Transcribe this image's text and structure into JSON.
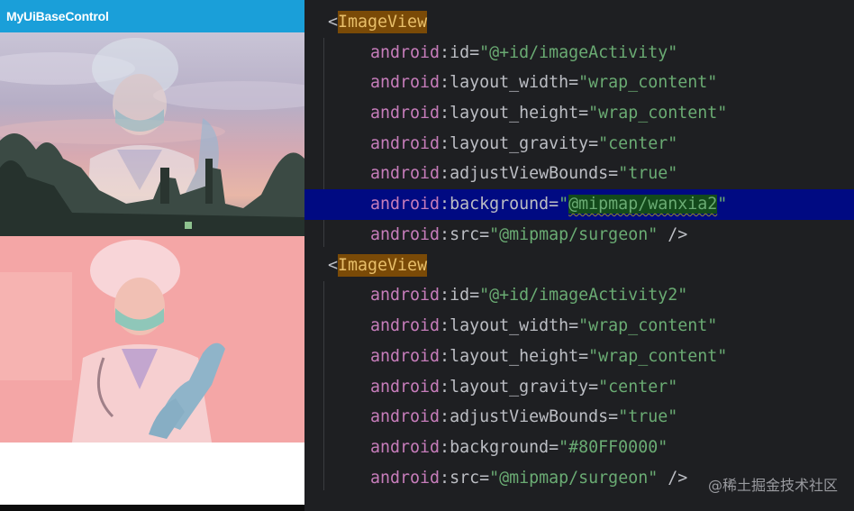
{
  "app": {
    "title": "MyUiBaseControl"
  },
  "colors": {
    "appbar": "#1a9fd9",
    "editor_background": "#1e1f22",
    "tag_name": "#e8bf6a",
    "namespace": "#c77dbb",
    "string": "#6aab73",
    "selection": "#000a82",
    "tint_overlay": "#80FF0000"
  },
  "preview": {
    "image1": {
      "subject": "surgeon",
      "background": "sunset sky over trees"
    },
    "image2": {
      "subject": "surgeon",
      "tint": "#80FF0000"
    }
  },
  "code": {
    "lines": [
      {
        "open": "<",
        "tag": "ImageView"
      },
      {
        "ns": "android",
        "attr": "id",
        "value": "\"@+id/imageActivity\""
      },
      {
        "ns": "android",
        "attr": "layout_width",
        "value": "\"wrap_content\""
      },
      {
        "ns": "android",
        "attr": "layout_height",
        "value": "\"wrap_content\""
      },
      {
        "ns": "android",
        "attr": "layout_gravity",
        "value": "\"center\""
      },
      {
        "ns": "android",
        "attr": "adjustViewBounds",
        "value": "\"true\""
      },
      {
        "ns": "android",
        "attr": "background",
        "value_open": "\"",
        "value_match": "@mipmap/wanxia2",
        "value_close": "\""
      },
      {
        "ns": "android",
        "attr": "src",
        "value": "\"@mipmap/surgeon\"",
        "tail": " />"
      },
      {
        "open": "<",
        "tag": "ImageView"
      },
      {
        "ns": "android",
        "attr": "id",
        "value": "\"@+id/imageActivity2\""
      },
      {
        "ns": "android",
        "attr": "layout_width",
        "value": "\"wrap_content\""
      },
      {
        "ns": "android",
        "attr": "layout_height",
        "value": "\"wrap_content\""
      },
      {
        "ns": "android",
        "attr": "layout_gravity",
        "value": "\"center\""
      },
      {
        "ns": "android",
        "attr": "adjustViewBounds",
        "value": "\"true\""
      },
      {
        "ns": "android",
        "attr": "background",
        "value": "\"#80FF0000\""
      },
      {
        "ns": "android",
        "attr": "src",
        "value": "\"@mipmap/surgeon\"",
        "tail": " />"
      }
    ]
  },
  "watermark": "@稀土掘金技术社区"
}
